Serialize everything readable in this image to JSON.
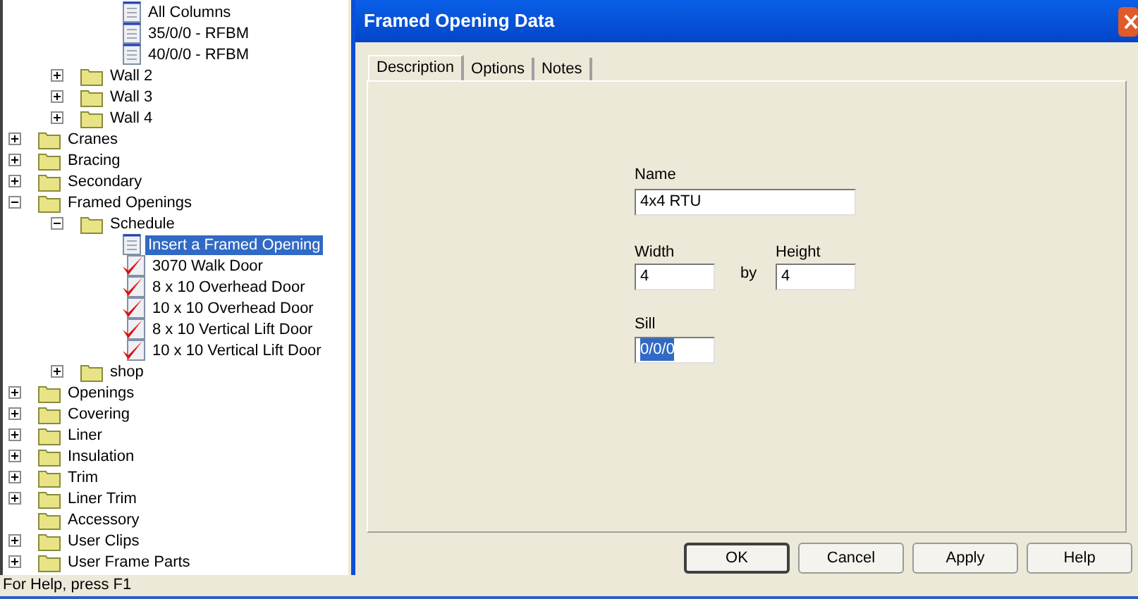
{
  "tree": [
    {
      "children": [
        {
          "children": [
            {
              "label": "All Columns",
              "kind": "page",
              "selected": false
            },
            {
              "label": "35/0/0 - RFBM",
              "kind": "page",
              "selected": false
            },
            {
              "label": "40/0/0 - RFBM",
              "kind": "page",
              "selected": false
            }
          ]
        },
        {
          "label": "Wall 2",
          "kind": "folder",
          "expanded": false,
          "selected": false
        },
        {
          "label": "Wall 3",
          "kind": "folder",
          "expanded": false,
          "selected": false
        },
        {
          "label": "Wall 4",
          "kind": "folder",
          "expanded": false,
          "selected": false
        }
      ]
    },
    {
      "label": "Cranes",
      "kind": "folder",
      "expanded": false,
      "selected": false
    },
    {
      "label": "Bracing",
      "kind": "folder",
      "expanded": false,
      "selected": false
    },
    {
      "label": "Secondary",
      "kind": "folder",
      "expanded": false,
      "selected": false
    },
    {
      "label": "Framed Openings",
      "kind": "folder",
      "expanded": true,
      "selected": false,
      "children": [
        {
          "label": "Schedule",
          "kind": "folder",
          "expanded": true,
          "selected": false,
          "children": [
            {
              "label": "Insert a Framed Opening",
              "kind": "page",
              "selected": true
            },
            {
              "label": "3070 Walk Door",
              "kind": "checked",
              "selected": false
            },
            {
              "label": "8 x 10 Overhead Door",
              "kind": "checked",
              "selected": false
            },
            {
              "label": "10 x 10 Overhead Door",
              "kind": "checked",
              "selected": false
            },
            {
              "label": "8 x 10 Vertical Lift Door",
              "kind": "checked",
              "selected": false
            },
            {
              "label": "10 x 10 Vertical Lift Door",
              "kind": "checked",
              "selected": false
            }
          ]
        },
        {
          "label": "shop",
          "kind": "folder",
          "expanded": false,
          "selected": false
        }
      ]
    },
    {
      "label": "Openings",
      "kind": "folder",
      "expanded": false,
      "selected": false
    },
    {
      "label": "Covering",
      "kind": "folder",
      "expanded": false,
      "selected": false
    },
    {
      "label": "Liner",
      "kind": "folder",
      "expanded": false,
      "selected": false
    },
    {
      "label": "Insulation",
      "kind": "folder",
      "expanded": false,
      "selected": false
    },
    {
      "label": "Trim",
      "kind": "folder",
      "expanded": false,
      "selected": false
    },
    {
      "label": "Liner Trim",
      "kind": "folder",
      "expanded": false,
      "selected": false
    },
    {
      "label": "Accessory",
      "kind": "folder",
      "selected": false
    },
    {
      "label": "User Clips",
      "kind": "folder",
      "expanded": false,
      "selected": false
    },
    {
      "label": "User Frame Parts",
      "kind": "folder",
      "expanded": false,
      "selected": false
    }
  ],
  "status_bar": "For Help, press F1",
  "dialog": {
    "title": "Framed Opening Data",
    "tabs": [
      {
        "label": "Description",
        "selected": true
      },
      {
        "label": "Options",
        "selected": false
      },
      {
        "label": "Notes",
        "selected": false
      }
    ],
    "name": {
      "label": "Name",
      "value": "4x4 RTU"
    },
    "width": {
      "label": "Width",
      "value": "4"
    },
    "by": "by",
    "height": {
      "label": "Height",
      "value": "4"
    },
    "sill": {
      "label": "Sill",
      "value": "0/0/0",
      "selected": true
    },
    "buttons": [
      {
        "label": "OK",
        "default": true
      },
      {
        "label": "Cancel",
        "default": false
      },
      {
        "label": "Apply",
        "default": false
      },
      {
        "label": "Help",
        "default": false
      }
    ]
  }
}
